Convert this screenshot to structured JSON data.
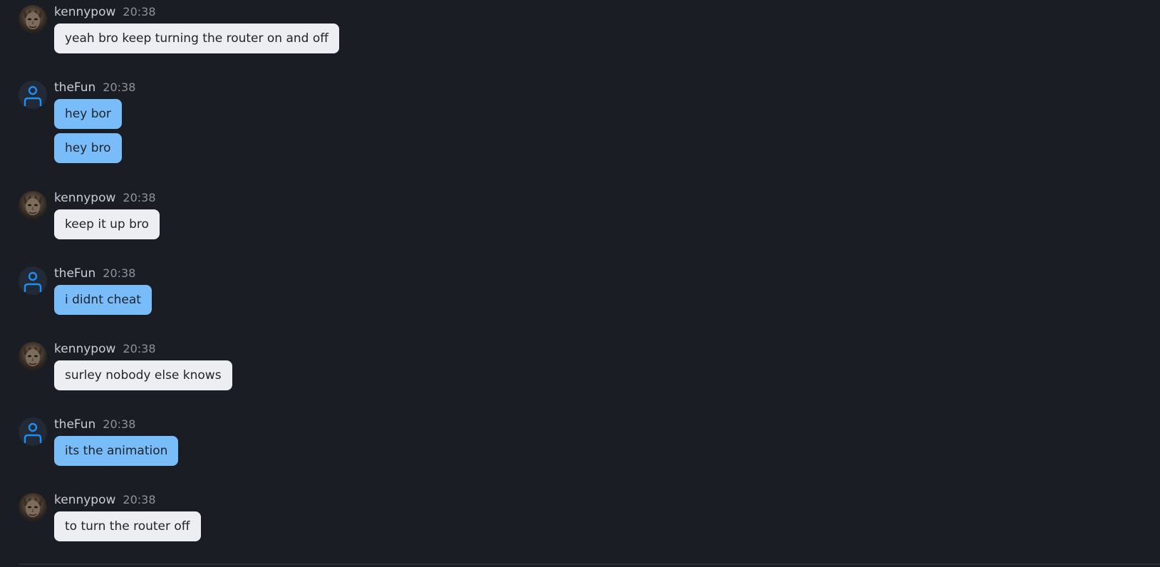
{
  "users": {
    "kenny": {
      "name": "kennypow",
      "avatar_icon": "demon-face-portrait-icon"
    },
    "thefun": {
      "name": "theFun",
      "avatar_icon": "user-icon",
      "avatar_color": "#1e8ff0"
    }
  },
  "colors": {
    "background": "#1b1d24",
    "incoming_bubble": "#eceef2",
    "outgoing_bubble": "#78bdfa"
  },
  "messages": [
    {
      "author": "kennypow",
      "time": "20:38",
      "texts": [
        "yeah bro keep turning the router on and off"
      ]
    },
    {
      "author": "theFun",
      "time": "20:38",
      "texts": [
        "hey bor",
        "hey bro"
      ]
    },
    {
      "author": "kennypow",
      "time": "20:38",
      "texts": [
        "keep it up bro"
      ]
    },
    {
      "author": "theFun",
      "time": "20:38",
      "texts": [
        "i didnt cheat"
      ]
    },
    {
      "author": "kennypow",
      "time": "20:38",
      "texts": [
        "surley nobody else knows"
      ]
    },
    {
      "author": "theFun",
      "time": "20:38",
      "texts": [
        "its the animation"
      ]
    },
    {
      "author": "kennypow",
      "time": "20:38",
      "texts": [
        "to turn the router off"
      ]
    }
  ]
}
